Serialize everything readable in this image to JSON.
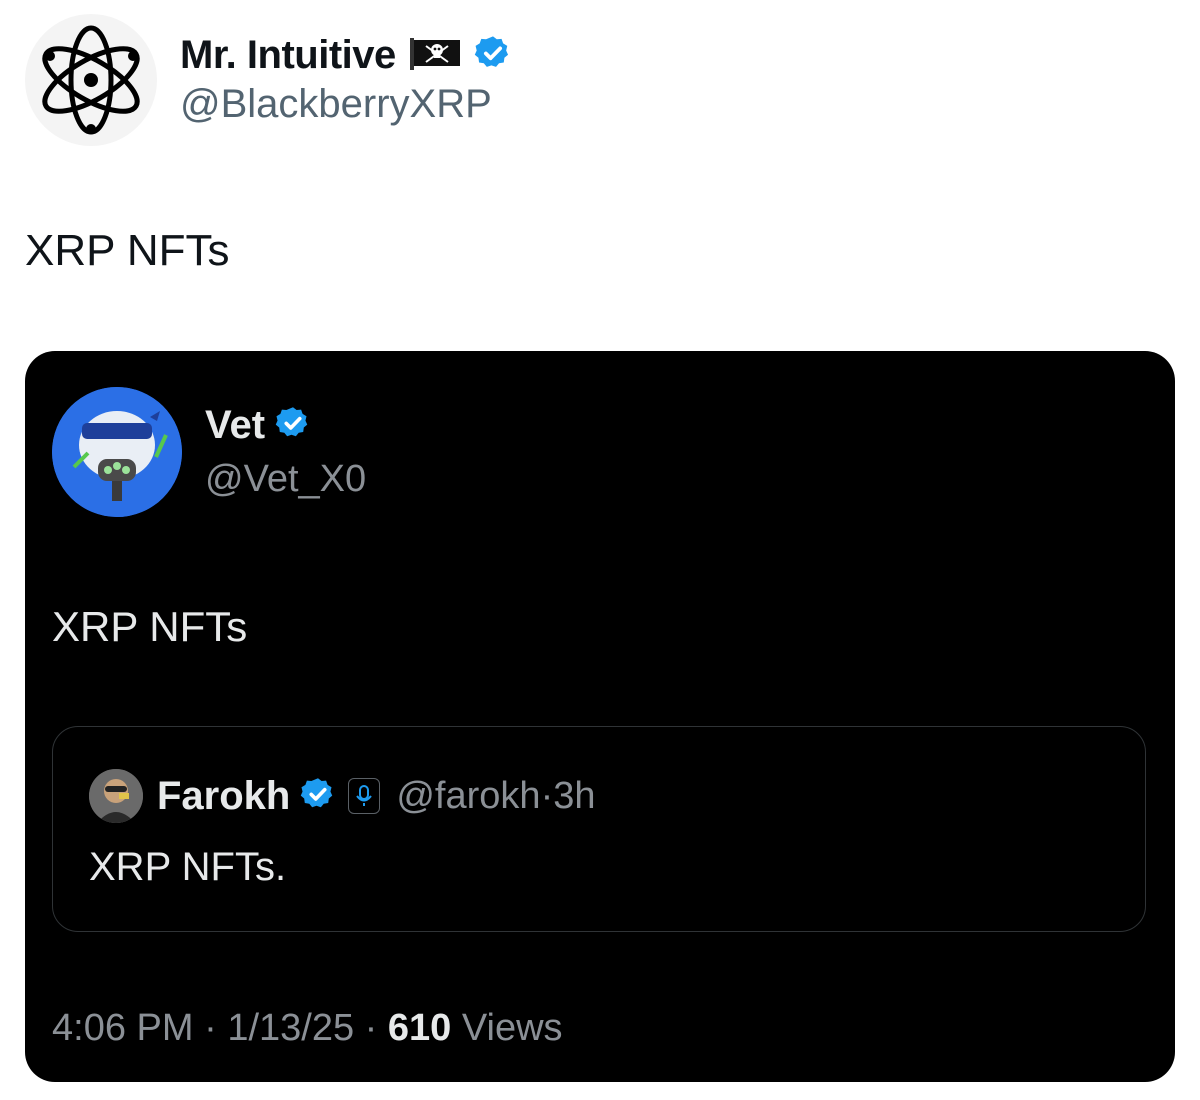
{
  "outer_tweet": {
    "author_name": "Mr. Intuitive",
    "flag_icon": "pirate-flag-icon",
    "verified_icon": "verified-badge-icon",
    "handle": "@BlackberryXRP",
    "text": "XRP NFTs"
  },
  "quoted_tweet": {
    "author_name": "Vet",
    "handle": "@Vet_X0",
    "text": "XRP NFTs",
    "nested_quote": {
      "author_name": "Farokh",
      "handle": "@farokh",
      "separator": "·",
      "age": "3h",
      "text": "XRP NFTs."
    },
    "meta": {
      "time": "4:06 PM",
      "date": "1/13/25",
      "views_count": "610",
      "views_label": "Views"
    }
  },
  "colors": {
    "verified_blue": "#1d9bf0",
    "card_bg": "#000000",
    "secondary_text": "#8b9096"
  }
}
